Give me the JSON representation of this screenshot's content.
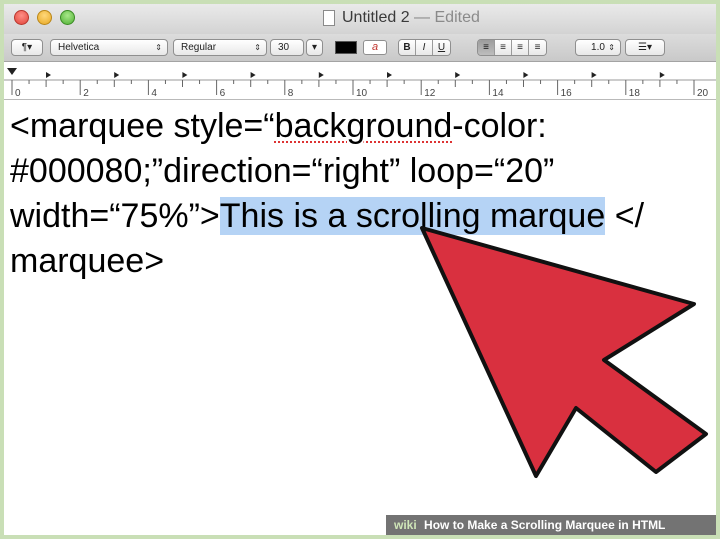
{
  "window": {
    "title": "Untitled 2",
    "separator": "—",
    "status": "Edited"
  },
  "toolbar": {
    "paragraph_label": "¶▾",
    "font_family": "Helvetica",
    "font_style": "Regular",
    "font_size": "30",
    "bold_label": "B",
    "italic_label": "I",
    "underline_label": "U",
    "line_spacing": "1.0",
    "list_label": "☰▾",
    "text_color": "#000000",
    "highlight_glyph": "a"
  },
  "ruler": {
    "labels": [
      "0",
      "2",
      "4",
      "6",
      "8",
      "10",
      "12",
      "14",
      "16",
      "18",
      "20"
    ]
  },
  "document": {
    "line1_prefix": "<marquee style=“",
    "line1_spell": "background",
    "line1_suffix": "-color:",
    "line2": "#000080;”direction=“right” loop=“20”",
    "line3_before": "width=“75%”>",
    "line3_selected": "This is a scrolling marque",
    "line3_after": " </",
    "line4": "marquee>"
  },
  "overlay": {
    "arrow_color": "#d9303f"
  },
  "footer": {
    "brand": "wiki",
    "caption": "How to Make a Scrolling Marquee in HTML"
  }
}
